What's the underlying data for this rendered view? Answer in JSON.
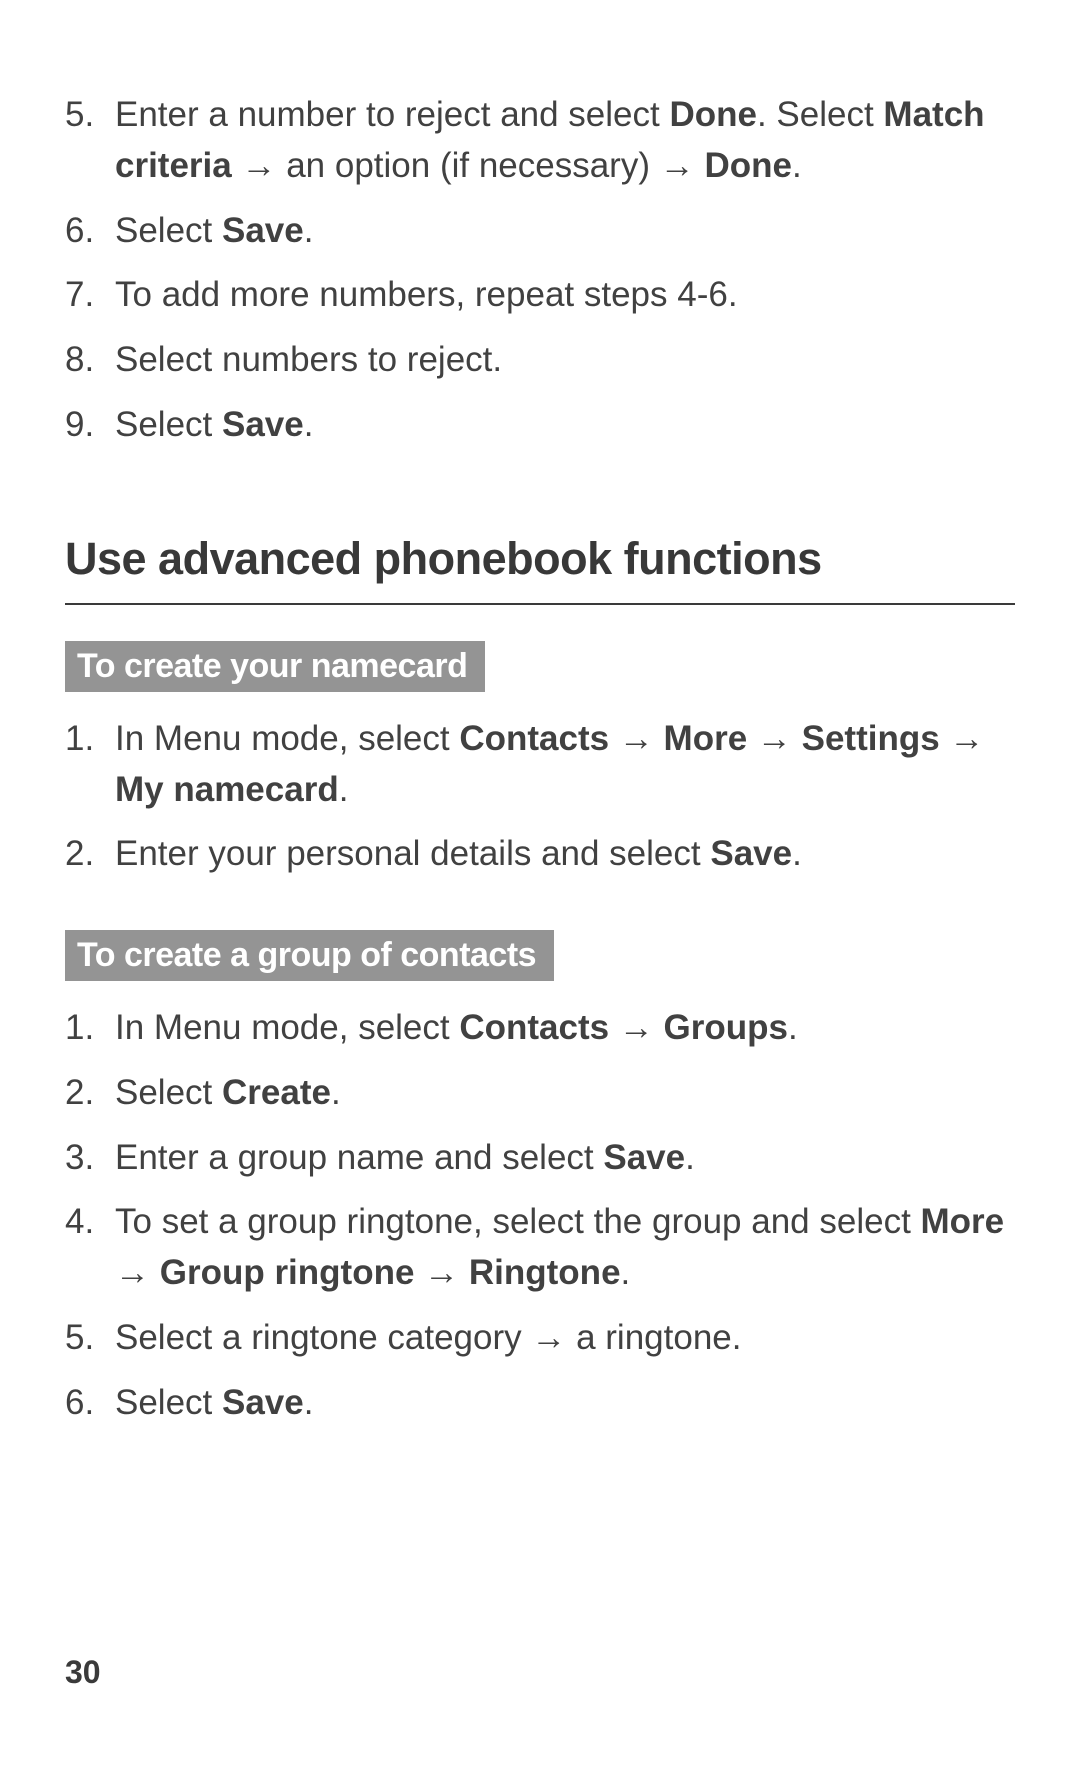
{
  "topSteps": [
    {
      "n": "5.",
      "parts": [
        "Enter a number to reject and select ",
        {
          "b": "Done"
        },
        ". Select ",
        {
          "b": "Match criteria"
        },
        " → an option (if necessary) → ",
        {
          "b": "Done"
        },
        "."
      ]
    },
    {
      "n": "6.",
      "parts": [
        "Select ",
        {
          "b": "Save"
        },
        "."
      ]
    },
    {
      "n": "7.",
      "parts": [
        "To add more numbers, repeat steps 4-6."
      ]
    },
    {
      "n": "8.",
      "parts": [
        "Select numbers to reject."
      ]
    },
    {
      "n": "9.",
      "parts": [
        "Select ",
        {
          "b": "Save"
        },
        "."
      ]
    }
  ],
  "sectionHeading": "Use advanced phonebook functions",
  "sub1": "To create your namecard",
  "sub1Steps": [
    {
      "n": "1.",
      "parts": [
        "In Menu mode, select ",
        {
          "b": "Contacts"
        },
        " → ",
        {
          "b": "More"
        },
        " → ",
        {
          "b": "Settings"
        },
        " → ",
        {
          "b": "My namecard"
        },
        "."
      ]
    },
    {
      "n": "2.",
      "parts": [
        "Enter your personal details and select ",
        {
          "b": "Save"
        },
        "."
      ]
    }
  ],
  "sub2": "To create a group of contacts",
  "sub2Steps": [
    {
      "n": "1.",
      "parts": [
        "In Menu mode, select ",
        {
          "b": "Contacts"
        },
        " → ",
        {
          "b": "Groups"
        },
        "."
      ]
    },
    {
      "n": "2.",
      "parts": [
        "Select ",
        {
          "b": "Create"
        },
        "."
      ]
    },
    {
      "n": "3.",
      "parts": [
        "Enter a group name and select ",
        {
          "b": "Save"
        },
        "."
      ]
    },
    {
      "n": "4.",
      "parts": [
        "To set a group ringtone, select the group and select ",
        {
          "b": "More"
        },
        " → ",
        {
          "b": "Group ringtone"
        },
        " → ",
        {
          "b": "Ringtone"
        },
        "."
      ]
    },
    {
      "n": "5.",
      "parts": [
        "Select a ringtone category → a ringtone."
      ]
    },
    {
      "n": "6.",
      "parts": [
        "Select ",
        {
          "b": "Save"
        },
        "."
      ]
    }
  ],
  "pageNumber": "30"
}
